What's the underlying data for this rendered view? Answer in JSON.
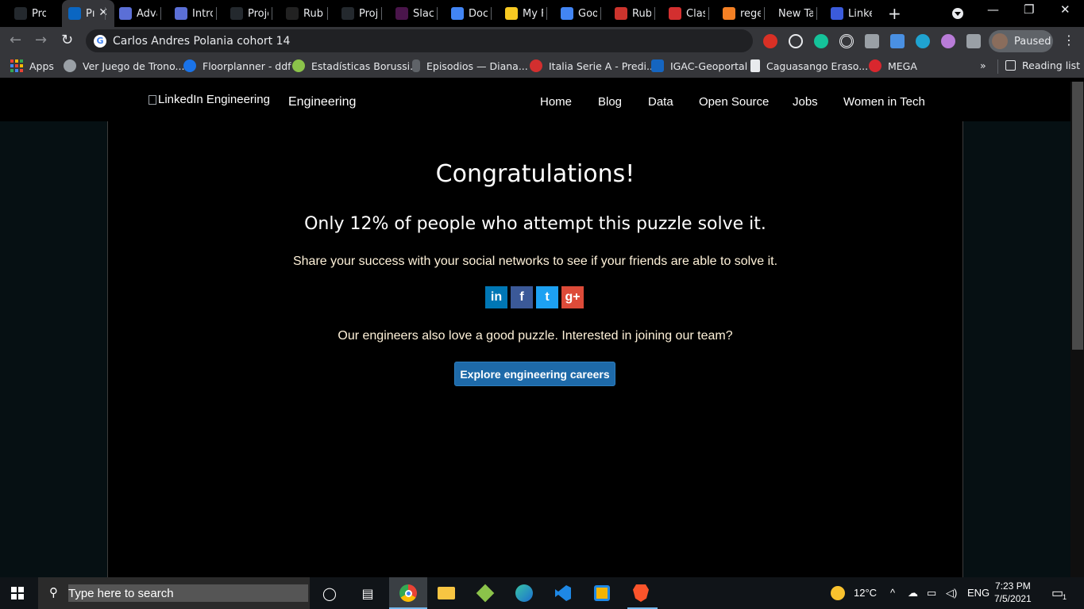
{
  "tabs": [
    {
      "label": "Proje",
      "icon": "github-icon",
      "color": "#24292e"
    },
    {
      "label": "Pı",
      "icon": "linkedin-icon",
      "color": "#0a66c2",
      "active": true
    },
    {
      "label": "Adva",
      "icon": "trello-icon",
      "color": "#5b6fd6"
    },
    {
      "label": "Intro",
      "icon": "trello-icon",
      "color": "#5b6fd6"
    },
    {
      "label": "Proje",
      "icon": "github-icon",
      "color": "#24292e"
    },
    {
      "label": "Rubu",
      "icon": "rubular-icon",
      "color": "#222"
    },
    {
      "label": "Proje",
      "icon": "github-icon",
      "color": "#24292e"
    },
    {
      "label": "Slack",
      "icon": "slack-icon",
      "color": "#4a154b"
    },
    {
      "label": "Docu",
      "icon": "docs-icon",
      "color": "#4285f4"
    },
    {
      "label": "My Fi",
      "icon": "miro-icon",
      "color": "#f7c922"
    },
    {
      "label": "Goog",
      "icon": "translate-icon",
      "color": "#4285f4"
    },
    {
      "label": "Ruby",
      "icon": "ruby-icon",
      "color": "#cc342d"
    },
    {
      "label": "Class",
      "icon": "class-icon",
      "color": "#d32f2f"
    },
    {
      "label": "rege",
      "icon": "stackoverflow-icon",
      "color": "#f48024"
    },
    {
      "label": "New Tab",
      "icon": "",
      "color": ""
    },
    {
      "label": "Linke",
      "icon": "linkedin-eng-icon",
      "color": "#3b5bdb"
    }
  ],
  "omnibox": {
    "text": "Carlos Andres Polania cohort 14"
  },
  "profile": {
    "label": "Paused"
  },
  "bookmarks": [
    {
      "label": "Apps"
    },
    {
      "label": "Ver Juego de Trono..."
    },
    {
      "label": "Floorplanner - ddf"
    },
    {
      "label": "Estadísticas Borussi..."
    },
    {
      "label": "Episodios — Diana..."
    },
    {
      "label": "Italia Serie A - Predi..."
    },
    {
      "label": "IGAC-Geoportal"
    },
    {
      "label": "Caguasango Eraso..."
    },
    {
      "label": "MEGA"
    }
  ],
  "reading_list": "Reading list",
  "overflow": "»",
  "site": {
    "logo_alt": "LinkedIn Engineering",
    "brand": "Engineering",
    "nav": [
      "Home",
      "Blog",
      "Data",
      "Open Source",
      "Jobs",
      "Women in Tech"
    ]
  },
  "content": {
    "title": "Congratulations!",
    "subtitle": "Only 12% of people who attempt this puzzle solve it.",
    "share_text": "Share your success with your social networks to see if your friends are able to solve it.",
    "social": [
      {
        "glyph": "in",
        "color": "#0077b5",
        "icon": "linkedin-share-icon"
      },
      {
        "glyph": "f",
        "color": "#3b5998",
        "icon": "facebook-share-icon"
      },
      {
        "glyph": "t",
        "color": "#1da1f2",
        "icon": "twitter-share-icon"
      },
      {
        "glyph": "g+",
        "color": "#dd4b39",
        "icon": "googleplus-share-icon"
      }
    ],
    "careers_text": "Our engineers also love a good puzzle. Interested in joining our team?",
    "cta_label": "Explore engineering careers"
  },
  "taskbar": {
    "search_placeholder": "Type here to search",
    "weather": "12°C",
    "language": "ENG",
    "time": "7:23 PM",
    "date": "7/5/2021",
    "notifications": "1"
  }
}
